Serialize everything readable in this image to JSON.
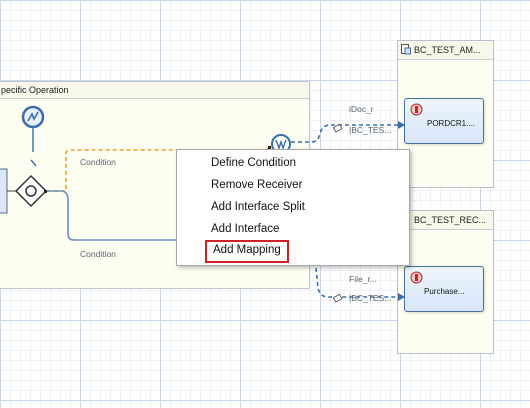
{
  "pool": {
    "title": "pecific Operation"
  },
  "connections": {
    "condition_top": "Condition",
    "condition_bottom": "Condition",
    "idoc_label": "iDoc_r",
    "bc_test_top": "|BC_TES...",
    "file_label": "File_r...",
    "bc_test_bottom": "|BC_TES..."
  },
  "lanes": [
    {
      "title": "BC_TEST_AM...",
      "receiver": "PORDCR1...."
    },
    {
      "title": "BC_TEST_REC...",
      "receiver": "Purchase..."
    }
  ],
  "context_menu": {
    "items": [
      {
        "label": "Define Condition"
      },
      {
        "label": "Remove Receiver"
      },
      {
        "label": "Add Interface Split"
      },
      {
        "label": "Add Interface"
      },
      {
        "label": "Add Mapping"
      }
    ],
    "highlighted_item": "Add Mapping",
    "highlight_color": "#d0202a"
  },
  "colors": {
    "condition_flow": "#f0a030",
    "flow_line": "#6b8fb8",
    "message_flow": "#3b6ea8"
  },
  "icons": [
    "timer-event-icon",
    "gateway-icon",
    "receiver-determination-icon",
    "document-icon",
    "system-icon",
    "message-icon"
  ]
}
